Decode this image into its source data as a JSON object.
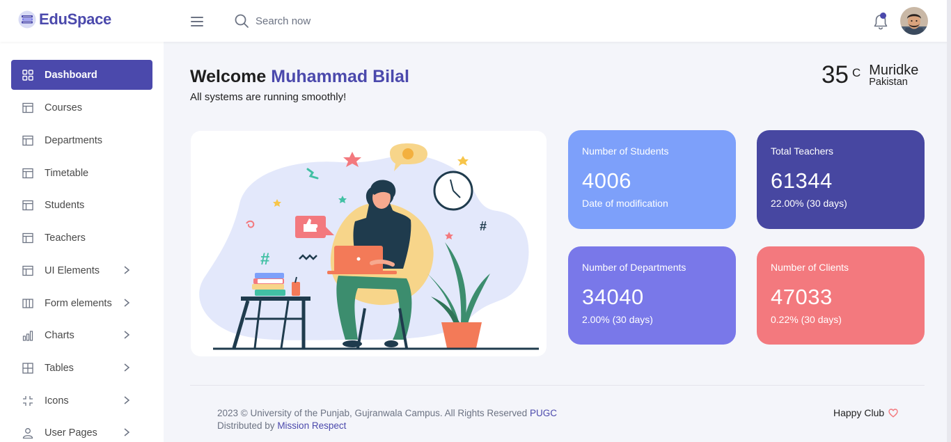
{
  "brand": {
    "name": "EduSpace",
    "icon": "books-logo-icon"
  },
  "header": {
    "search_placeholder": "Search now",
    "colors": {
      "accent": "#4b49ac"
    }
  },
  "sidebar": {
    "items": [
      {
        "label": "Dashboard",
        "icon": "grid-icon",
        "active": true,
        "has_submenu": false
      },
      {
        "label": "Courses",
        "icon": "layout-icon",
        "has_submenu": false
      },
      {
        "label": "Departments",
        "icon": "layout-icon",
        "has_submenu": false
      },
      {
        "label": "Timetable",
        "icon": "layout-icon",
        "has_submenu": false
      },
      {
        "label": "Students",
        "icon": "layout-icon",
        "has_submenu": false
      },
      {
        "label": "Teachers",
        "icon": "layout-icon",
        "has_submenu": false
      },
      {
        "label": "UI Elements",
        "icon": "layout-icon",
        "has_submenu": true
      },
      {
        "label": "Form elements",
        "icon": "columns-icon",
        "has_submenu": true
      },
      {
        "label": "Charts",
        "icon": "bar-chart-icon",
        "has_submenu": true
      },
      {
        "label": "Tables",
        "icon": "table-icon",
        "has_submenu": true
      },
      {
        "label": "Icons",
        "icon": "expand-icon",
        "has_submenu": true
      },
      {
        "label": "User Pages",
        "icon": "user-icon",
        "has_submenu": true
      }
    ]
  },
  "welcome": {
    "greeting": "Welcome",
    "user_name": "Muhammad Bilal",
    "status": "All systems are running smoothly!"
  },
  "weather": {
    "temperature": "35",
    "unit": "C",
    "city": "Muridke",
    "country": "Pakistan"
  },
  "stats": [
    {
      "label": "Number of Students",
      "value": "4006",
      "note": "Date of modification",
      "color": "#7da0fa"
    },
    {
      "label": "Total Teachers",
      "value": "61344",
      "note": "22.00% (30 days)",
      "color": "#4747a1"
    },
    {
      "label": "Number of Departments",
      "value": "34040",
      "note": "2.00% (30 days)",
      "color": "#7978e9"
    },
    {
      "label": "Number of Clients",
      "value": "47033",
      "note": "0.22% (30 days)",
      "color": "#f3797e"
    }
  ],
  "footer": {
    "copyright": "2023 © University of the Punjab, Gujranwala Campus. All Rights Reserved",
    "copyright_link": "PUGC",
    "distributed_prefix": "Distributed by",
    "distributed_link": "Mission Respect",
    "club": "Happy Club"
  }
}
